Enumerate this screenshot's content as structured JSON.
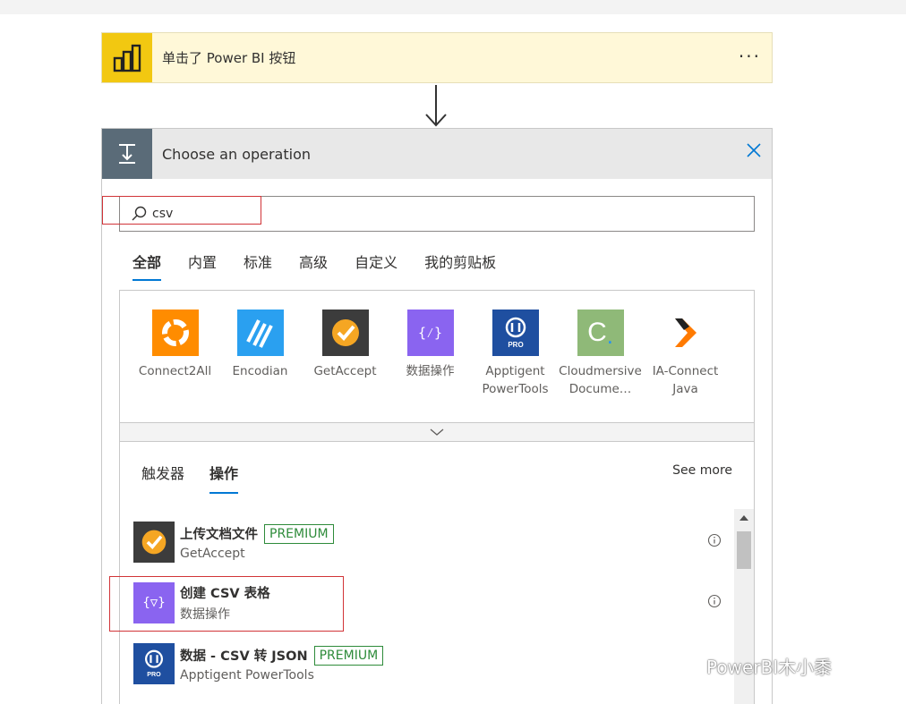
{
  "trigger": {
    "title": "单击了 Power BI 按钮",
    "more": "···",
    "icon": "powerbi-icon",
    "accent": "#f2c811"
  },
  "panel": {
    "title": "Choose an operation",
    "icon": "operation-icon",
    "close_icon": "close-icon",
    "search": {
      "value": "csv",
      "placeholder": ""
    },
    "tabs": [
      {
        "label": "全部",
        "active": true
      },
      {
        "label": "内置",
        "active": false
      },
      {
        "label": "标准",
        "active": false
      },
      {
        "label": "高级",
        "active": false
      },
      {
        "label": "自定义",
        "active": false
      },
      {
        "label": "我的剪贴板",
        "active": false
      }
    ],
    "connectors": [
      {
        "label": "Connect2All",
        "icon": "connect2all-icon",
        "color": "#ff8c00"
      },
      {
        "label": "Encodian",
        "icon": "encodian-icon",
        "color": "#2aa0f0"
      },
      {
        "label": "GetAccept",
        "icon": "getaccept-icon",
        "color": "#3c3c3c"
      },
      {
        "label": "数据操作",
        "icon": "data-operations-icon",
        "color": "#8a64f0"
      },
      {
        "label": "Apptigent PowerTools",
        "icon": "apptigent-icon",
        "color": "#1f4fa0"
      },
      {
        "label": "Cloudmersive Docume…",
        "icon": "cloudmersive-icon",
        "color": "#8fb978"
      },
      {
        "label": "IA-Connect Java",
        "icon": "ia-connect-icon",
        "color": "#ff7a00"
      }
    ],
    "subtabs": [
      {
        "label": "触发器",
        "active": false
      },
      {
        "label": "操作",
        "active": true
      }
    ],
    "see_more": "See more",
    "actions": [
      {
        "title": "上传文档文件",
        "badge": "PREMIUM",
        "sub": "GetAccept",
        "icon": "getaccept-icon",
        "color": "#3c3c3c"
      },
      {
        "title": "创建 CSV 表格",
        "badge": "",
        "sub": "数据操作",
        "icon": "data-operations-icon",
        "color": "#8a64f0"
      },
      {
        "title": "数据 - CSV 转 JSON",
        "badge": "PREMIUM",
        "sub": "Apptigent PowerTools",
        "icon": "apptigent-icon",
        "color": "#1f4fa0"
      }
    ]
  },
  "watermark": "PowerBI木小黍",
  "colors": {
    "premium": "#2e8b3a",
    "highlight": "#d13438",
    "accent": "#0078d4"
  }
}
